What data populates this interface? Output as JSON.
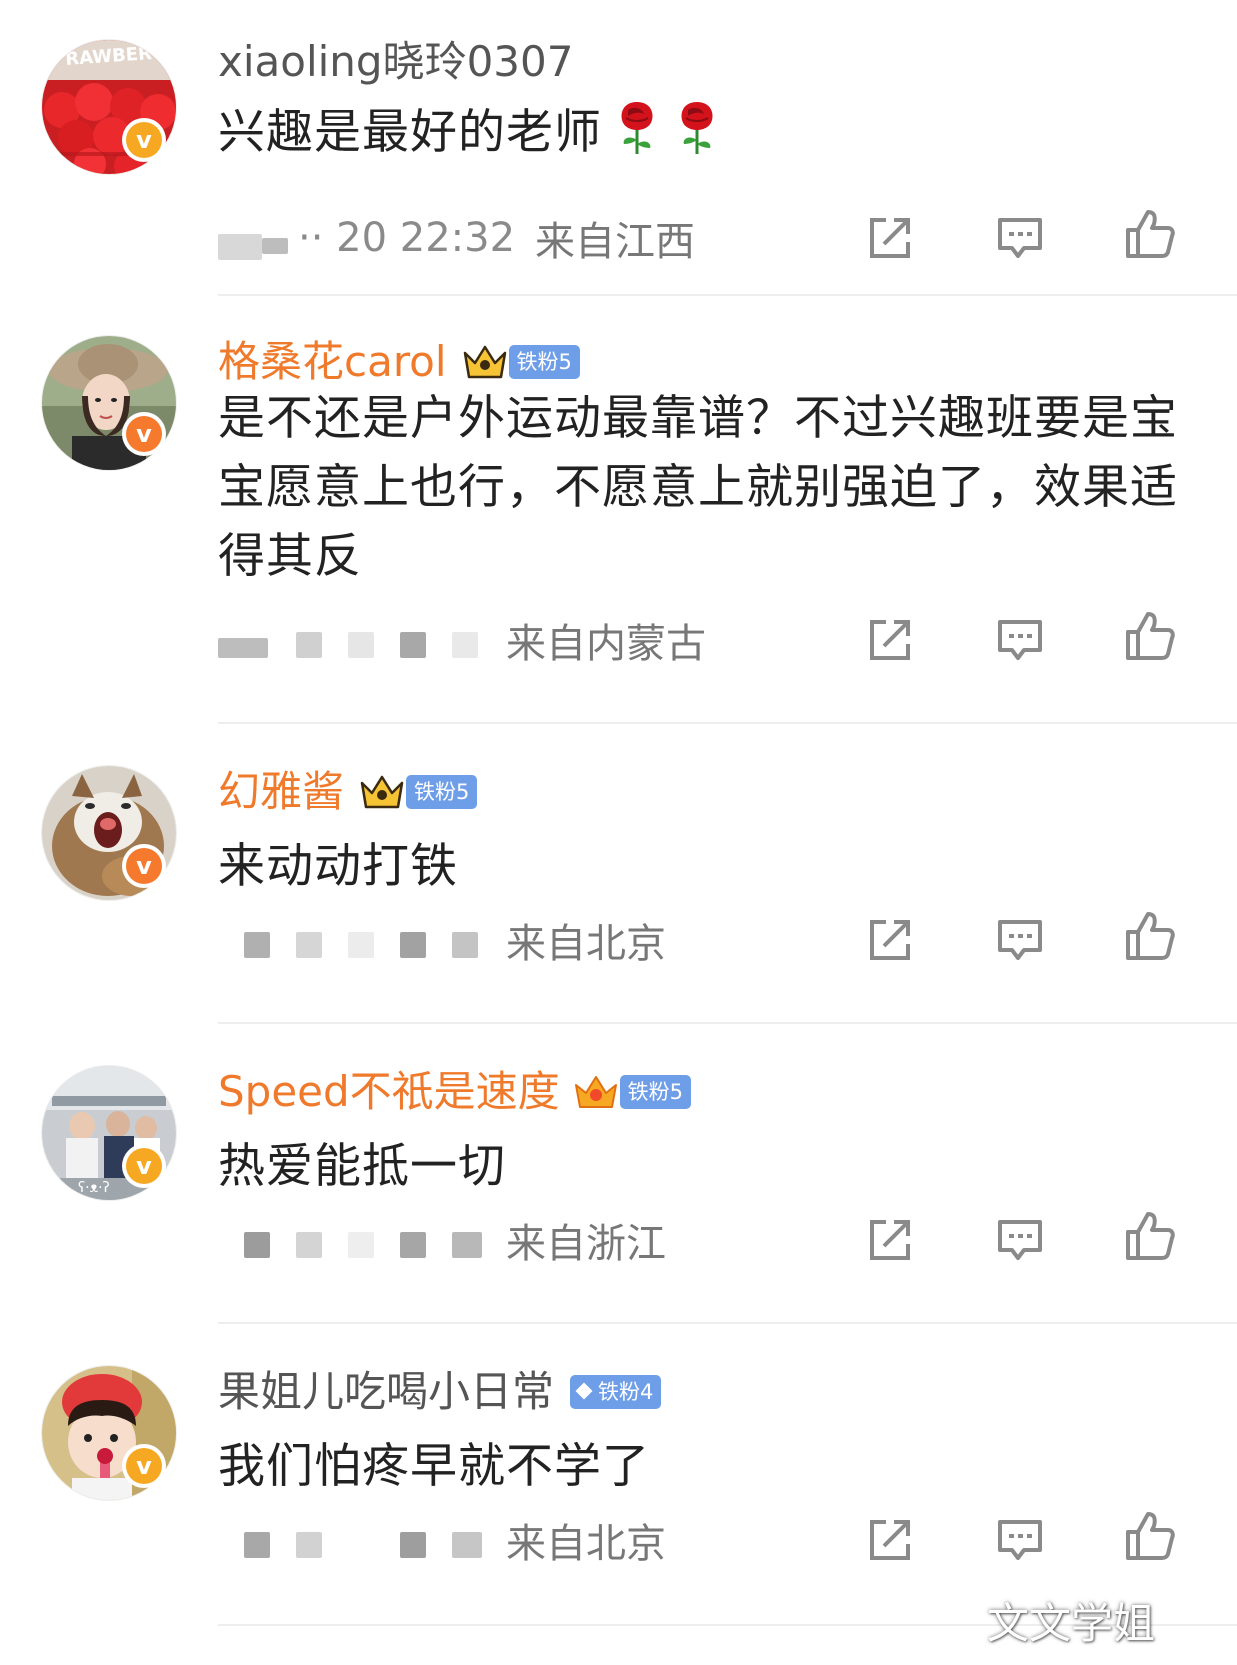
{
  "colors": {
    "vip_name": "#f07a2b",
    "normal_name": "#555555",
    "badge_blue": "#6f9ee8",
    "verify_orange": "#f7a823",
    "verify_orange_deep": "#f57a2e",
    "icon_gray": "#8a8a8a"
  },
  "comments": [
    {
      "username": "xiaoling晓玲0307",
      "name_style": "normal",
      "has_crown": false,
      "fan_badge": "",
      "text": "兴趣是最好的老师",
      "emoji": [
        "rose",
        "rose"
      ],
      "timestamp_visible": "·· 20 22:32",
      "location": "来自江西",
      "avatar_label": "RAWBER"
    },
    {
      "username": "格桑花carol",
      "name_style": "vip",
      "has_crown": true,
      "fan_badge": "铁粉5",
      "text": "是不还是户外运动最靠谱？不过兴趣班要是宝宝愿意上也行，不愿意上就别强迫了，效果适得其反",
      "location": "来自内蒙古"
    },
    {
      "username": "幻雅酱",
      "name_style": "vip",
      "has_crown": true,
      "fan_badge": "铁粉5",
      "text": "来动动打铁",
      "location": "来自北京"
    },
    {
      "username": "Speed不祇是速度",
      "name_style": "vip",
      "has_crown": true,
      "fan_badge": "铁粉5",
      "text": "热爱能抵一切",
      "location": "来自浙江"
    },
    {
      "username": "果姐儿吃喝小日常",
      "name_style": "normal",
      "has_crown": false,
      "fan_badge": "铁粉4",
      "text": "我们怕疼早就不学了",
      "location": "来自北京"
    }
  ],
  "actions": {
    "share_icon": "share-icon",
    "reply_icon": "comment-icon",
    "like_icon": "thumbs-up-icon"
  },
  "watermark": "文文学姐"
}
